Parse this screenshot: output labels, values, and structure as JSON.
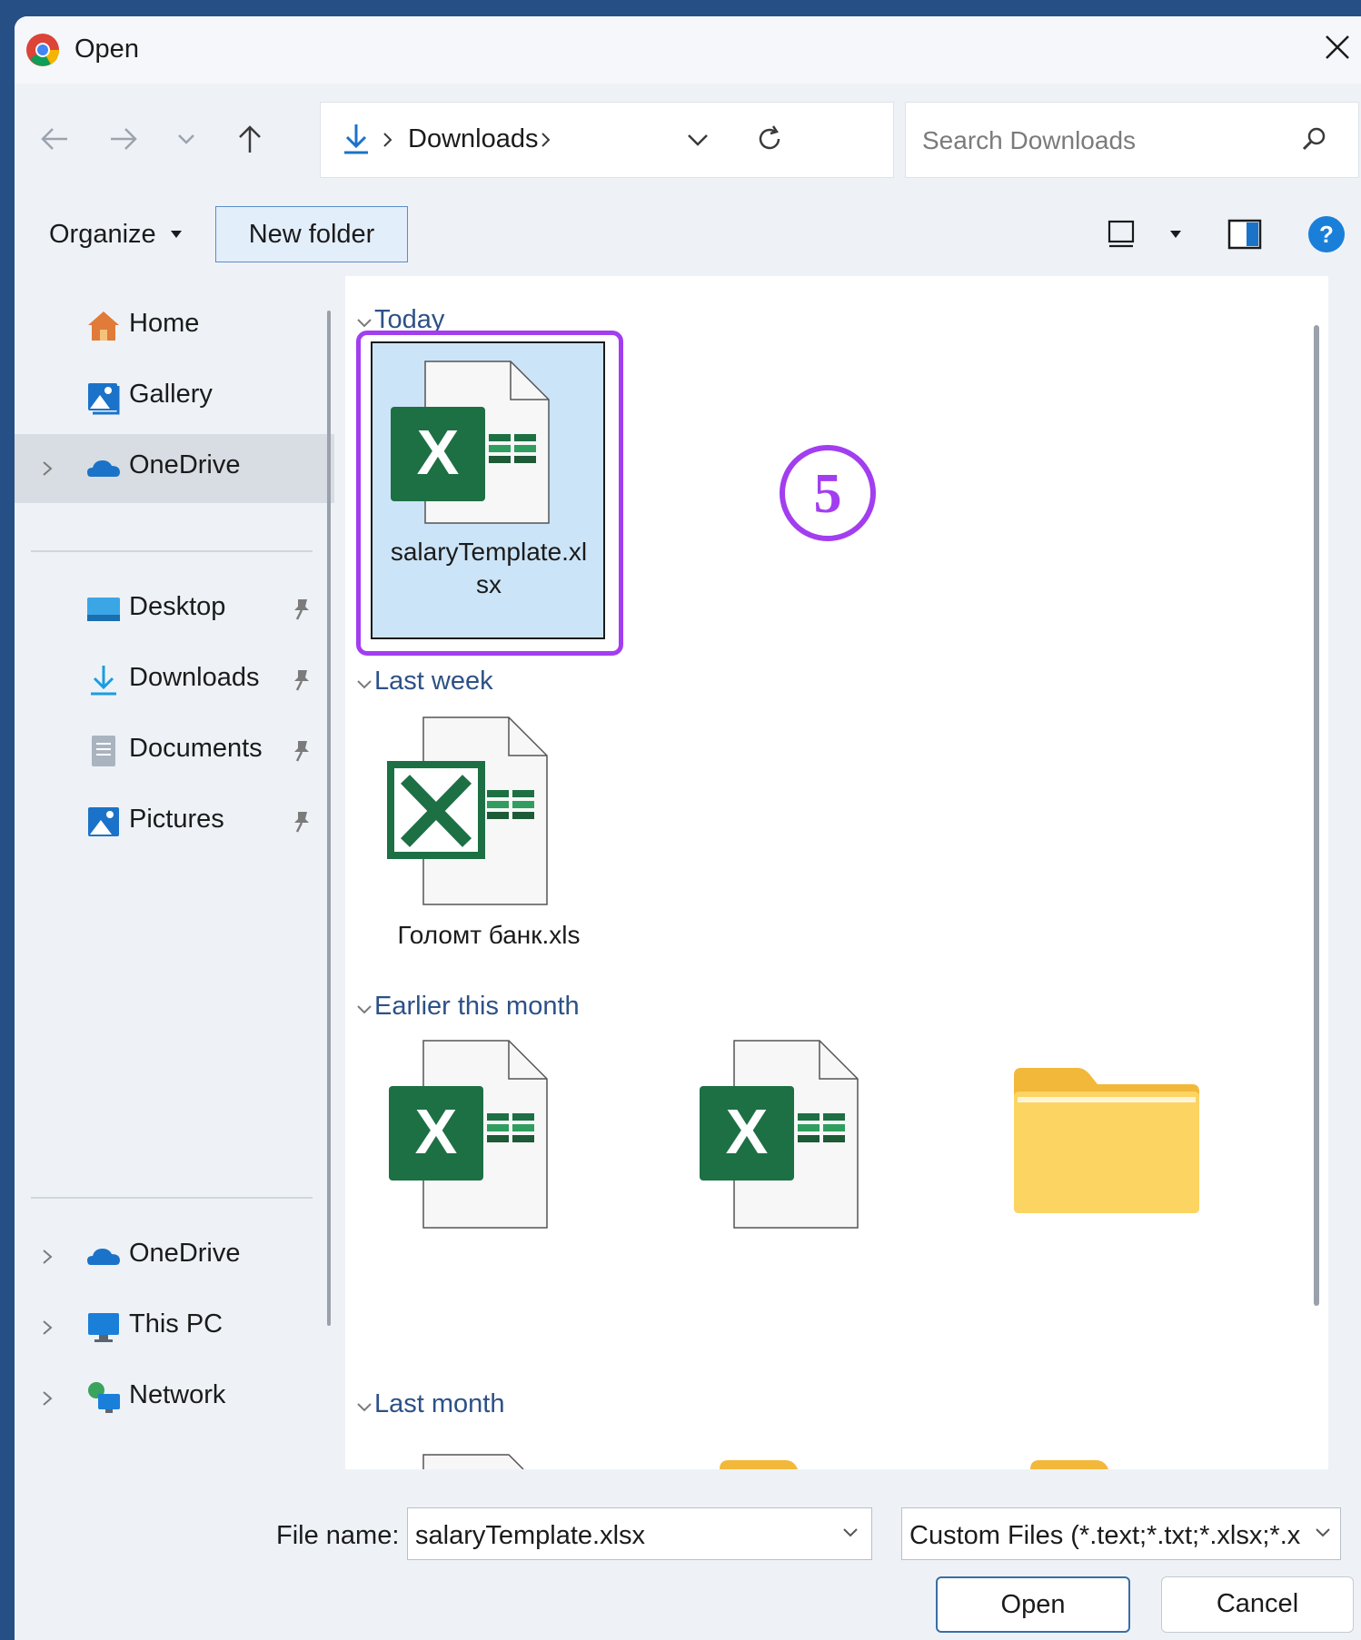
{
  "window": {
    "title": "Open"
  },
  "address_bar": {
    "segments": [
      "Downloads"
    ]
  },
  "search": {
    "placeholder": "Search Downloads"
  },
  "toolbar": {
    "organize_label": "Organize",
    "new_folder_label": "New folder"
  },
  "sidebar": {
    "quick": [
      {
        "label": "Home",
        "icon": "home-icon"
      },
      {
        "label": "Gallery",
        "icon": "gallery-icon"
      },
      {
        "label": "OneDrive",
        "icon": "onedrive-icon",
        "selected": true
      }
    ],
    "pinned": [
      {
        "label": "Desktop",
        "icon": "desktop-icon"
      },
      {
        "label": "Downloads",
        "icon": "downloads-icon"
      },
      {
        "label": "Documents",
        "icon": "documents-icon"
      },
      {
        "label": "Pictures",
        "icon": "pictures-icon"
      }
    ],
    "locations": [
      {
        "label": "OneDrive",
        "icon": "onedrive-icon"
      },
      {
        "label": "This PC",
        "icon": "this-pc-icon"
      },
      {
        "label": "Network",
        "icon": "network-icon"
      }
    ]
  },
  "groups": [
    {
      "heading": "Today",
      "files": [
        {
          "name_line1": "salaryTemplate.xl",
          "name_line2": "sx",
          "type": "excel",
          "selected": true
        }
      ]
    },
    {
      "heading": "Last week",
      "files": [
        {
          "name": "Голомт банк.xls",
          "type": "excel-legacy"
        }
      ]
    },
    {
      "heading": "Earlier this month",
      "files": [
        {
          "type": "excel"
        },
        {
          "type": "excel"
        },
        {
          "type": "folder"
        }
      ]
    },
    {
      "heading": "Last month",
      "files": [
        {
          "type": "file"
        },
        {
          "type": "folder"
        },
        {
          "type": "folder"
        }
      ]
    }
  ],
  "annotation": {
    "step": "5"
  },
  "footer": {
    "file_name_label": "File name:",
    "file_name_value": "salaryTemplate.xlsx",
    "file_type_value": "Custom Files (*.text;*.txt;*.xlsx;*.x",
    "open_label": "Open",
    "cancel_label": "Cancel"
  },
  "colors": {
    "accent": "#a23ef0",
    "selection": "#cce4f7",
    "excel_green": "#1d7044"
  }
}
